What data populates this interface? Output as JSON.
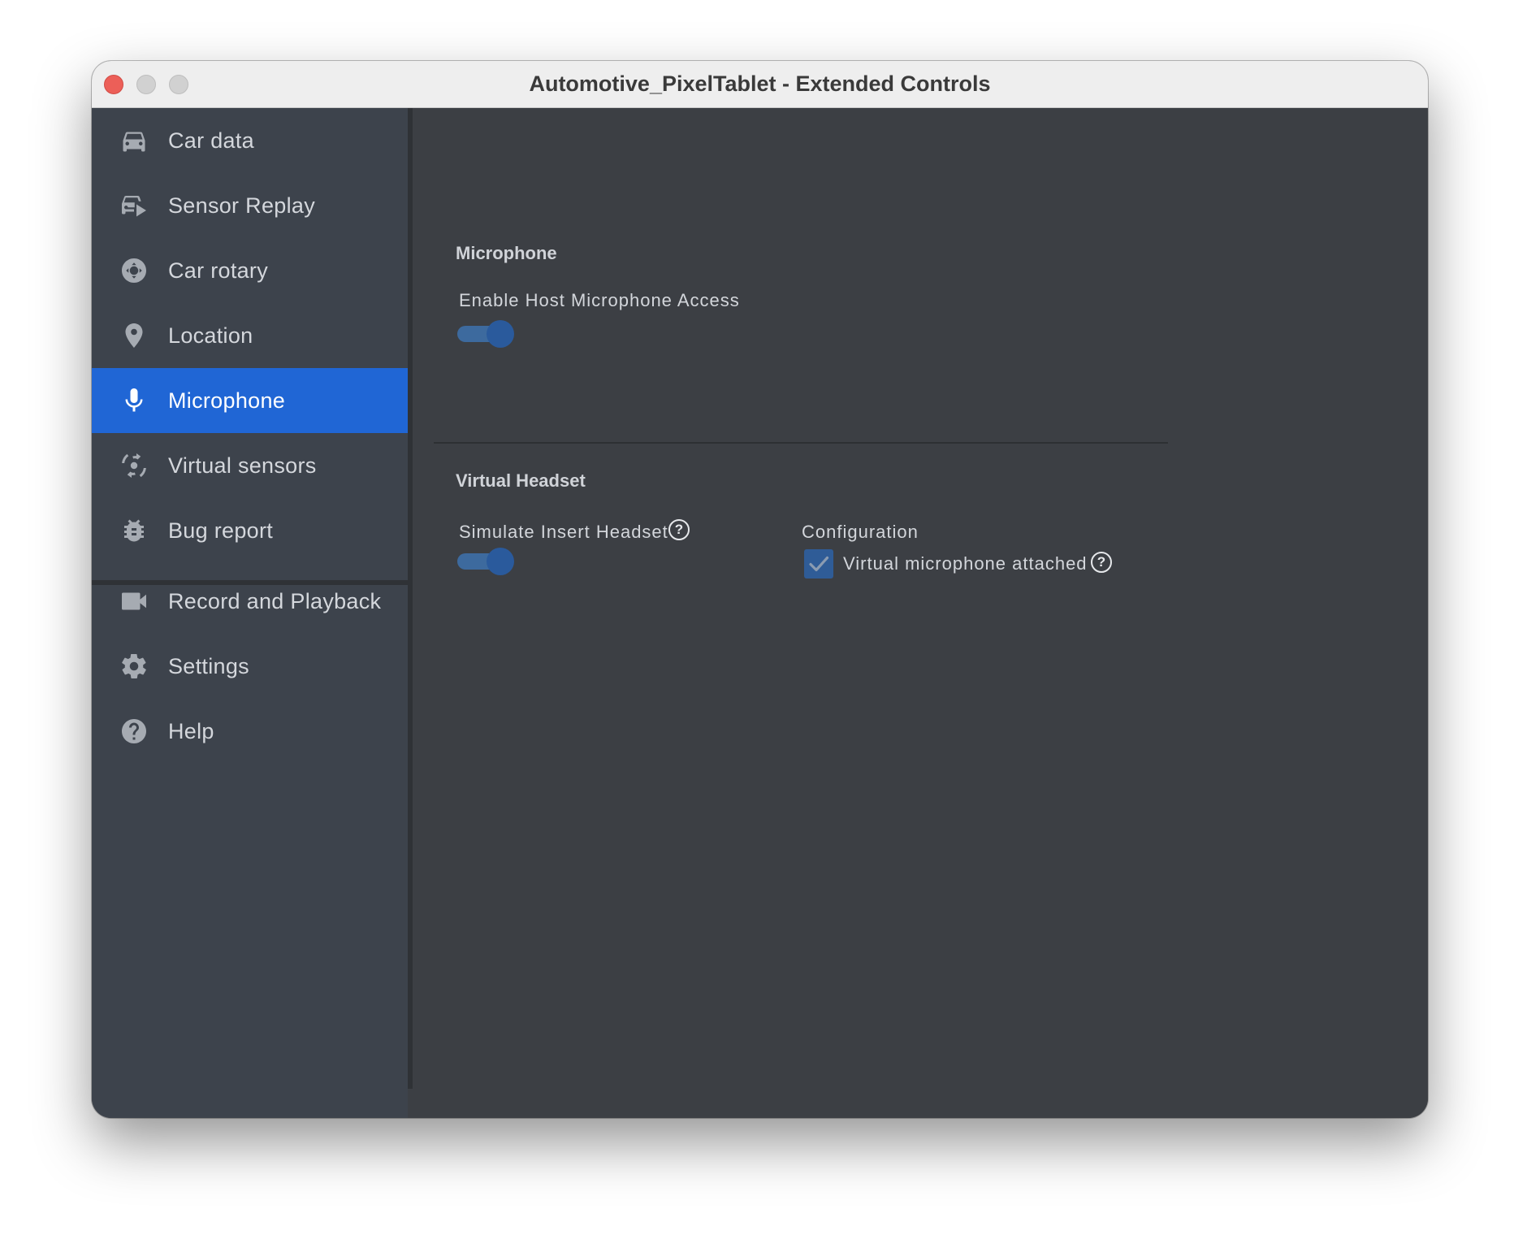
{
  "window": {
    "title": "Automotive_PixelTablet - Extended Controls"
  },
  "sidebar": {
    "items": [
      {
        "label": "Car data",
        "icon": "car-icon"
      },
      {
        "label": "Sensor Replay",
        "icon": "sensor-replay-icon"
      },
      {
        "label": "Car rotary",
        "icon": "rotary-icon"
      },
      {
        "label": "Location",
        "icon": "location-pin-icon"
      },
      {
        "label": "Microphone",
        "icon": "microphone-icon",
        "active": true
      },
      {
        "label": "Virtual sensors",
        "icon": "virtual-sensors-icon"
      },
      {
        "label": "Bug report",
        "icon": "bug-icon"
      },
      {
        "label": "Record and Playback",
        "icon": "video-camera-icon"
      },
      {
        "label": "Settings",
        "icon": "gear-icon"
      },
      {
        "label": "Help",
        "icon": "help-circle-icon"
      }
    ]
  },
  "main": {
    "microphone": {
      "title": "Microphone",
      "host_access_label": "Enable Host Microphone Access",
      "host_access_enabled": true
    },
    "virtual_headset": {
      "title": "Virtual Headset",
      "simulate_label": "Simulate Insert Headset",
      "simulate_enabled": true,
      "configuration_label": "Configuration",
      "virtual_mic_label": "Virtual microphone attached",
      "virtual_mic_checked": true
    }
  },
  "colors": {
    "sidebar_bg": "#3d434c",
    "main_bg": "#3c3f44",
    "accent": "#2066d5",
    "toggle_on": "#2a5a9c"
  }
}
